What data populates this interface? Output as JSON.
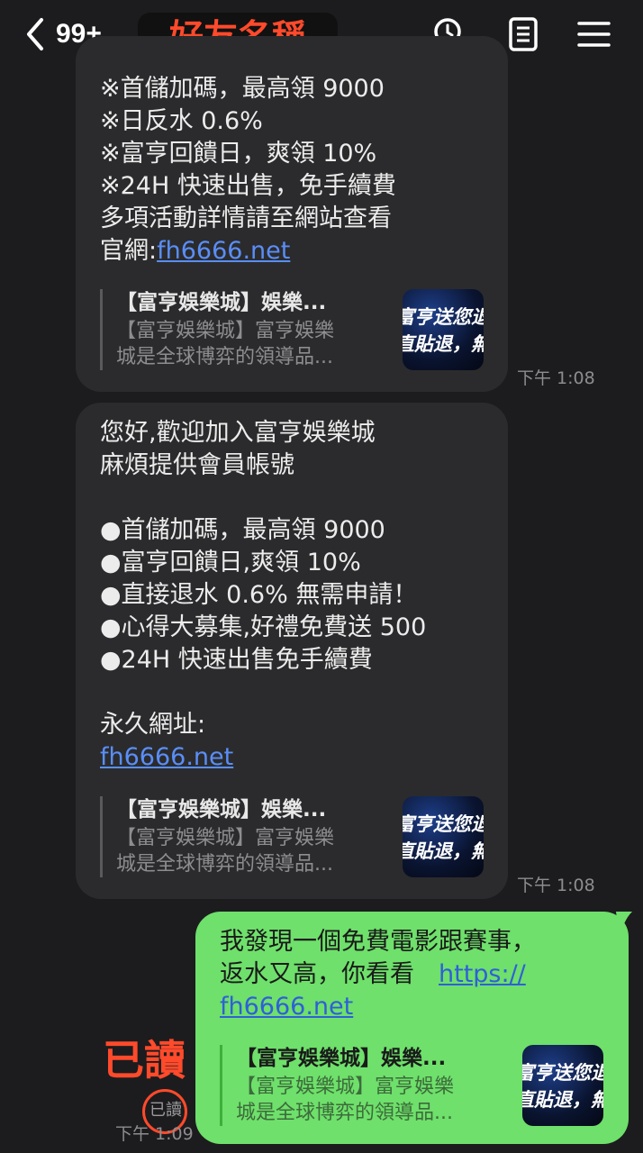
{
  "header": {
    "back_icon": "chevron-left-icon",
    "unread_count": "99+",
    "friend_name": "好友名稱",
    "icons": [
      "search-icon",
      "notes-icon",
      "menu-icon"
    ]
  },
  "messages": [
    {
      "direction": "received",
      "lines": [
        "※首儲加碼，最高領 9000",
        "※日反水 0.6%",
        "※富亨回饋日，爽領 10%",
        "※24H 快速出售，免手續費",
        "多項活動詳情請至網站查看"
      ],
      "link_prefix": "官網:",
      "link": "fh6666.net",
      "preview": {
        "title": "【富亨娛樂城】娛樂...",
        "desc_line1": "【富亨娛樂城】富亨娛樂",
        "desc_line2": "城是全球博弈的領導品...",
        "thumb_line1": "富亨送您退",
        "thumb_line2": "直貼退，無"
      },
      "time": "下午 1:08"
    },
    {
      "direction": "received",
      "lines": [
        "您好,歡迎加入富亨娛樂城",
        "麻煩提供會員帳號",
        "",
        "●首儲加碼，最高領 9000",
        "●富亨回饋日,爽領 10%",
        "●直接退水 0.6% 無需申請！",
        "●心得大募集,好禮免費送 500",
        "●24H 快速出售免手續費",
        "",
        "永久網址:"
      ],
      "link": "fh6666.net",
      "preview": {
        "title": "【富亨娛樂城】娛樂...",
        "desc_line1": "【富亨娛樂城】富亨娛樂",
        "desc_line2": "城是全球博弈的領導品...",
        "thumb_line1": "富亨送您退",
        "thumb_line2": "直貼退，無"
      },
      "time": "下午 1:08"
    },
    {
      "direction": "sent",
      "line1": "我發現一個免費電影跟賽事，",
      "line2_text": "返水又高，你看看　",
      "line2_link": "https://",
      "line3_link": "fh6666.net",
      "preview": {
        "title": "【富亨娛樂城】娛樂...",
        "desc_line1": "【富亨娛樂城】富亨娛樂",
        "desc_line2": "城是全球博弈的領導品...",
        "thumb_line1": "富亨送您退",
        "thumb_line2": "直貼退，無"
      },
      "read_label": "已讀",
      "time": "下午 1:09"
    }
  ],
  "annotation": {
    "read_text": "已讀",
    "color": "#ff4a2b"
  },
  "colors": {
    "background": "#1c1c1e",
    "received_bubble": "#2b2b2d",
    "sent_bubble": "#6ee06b",
    "link": "#5a8ef7"
  }
}
